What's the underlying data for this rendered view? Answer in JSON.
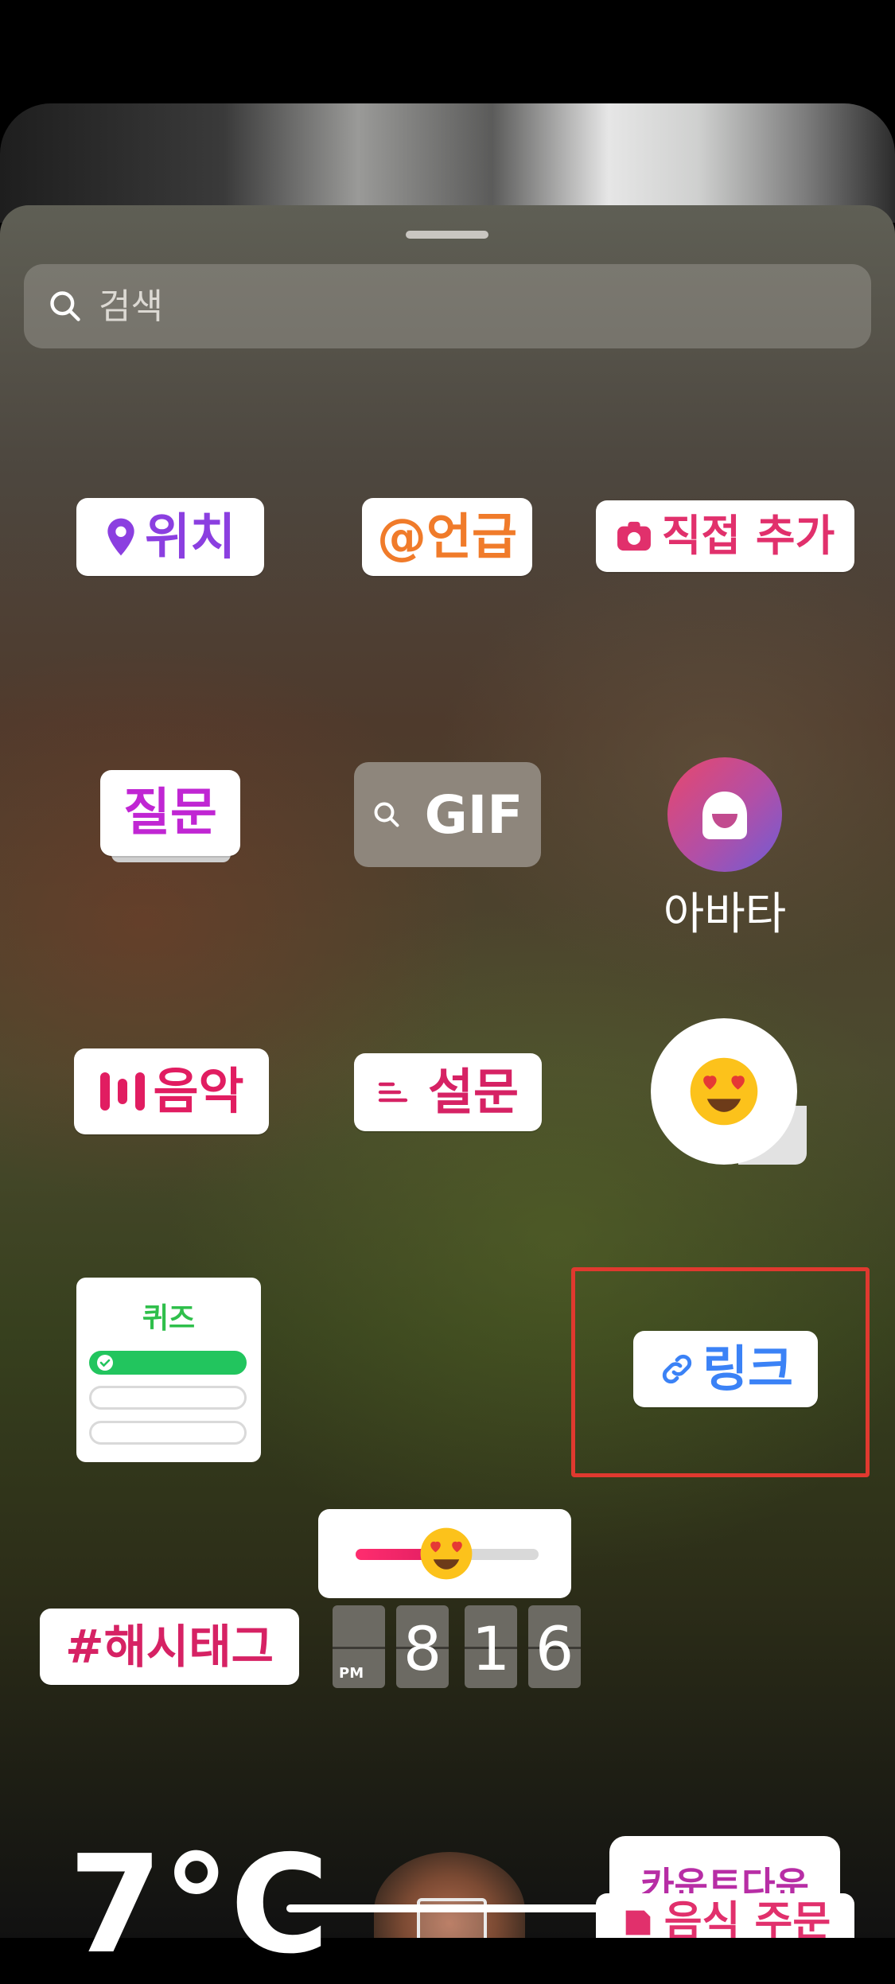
{
  "search": {
    "placeholder": "검색"
  },
  "stickers": {
    "location": "위치",
    "mention": "언급",
    "add_yours": "직접 추가",
    "questions": "질문",
    "gif": "GIF",
    "avatar": "아바타",
    "music": "음악",
    "poll": "설문",
    "quiz": "퀴즈",
    "link": "링크",
    "hashtag": "#해시태그",
    "time": {
      "ampm": "PM",
      "hour": "8",
      "minute_tens": "1",
      "minute_ones": "6"
    },
    "countdown": "카운트다운",
    "temperature": "7°C",
    "food_order": "음식 주문"
  },
  "colors": {
    "location": "#8b3fe0",
    "mention": "#f07b2a",
    "add_yours": "#e1306c",
    "questions": "#c026d3",
    "music": "#e11d61",
    "poll": "#d62264",
    "link": "#3b82f6",
    "hashtag": "#d62264",
    "highlight": "#e0392f"
  }
}
